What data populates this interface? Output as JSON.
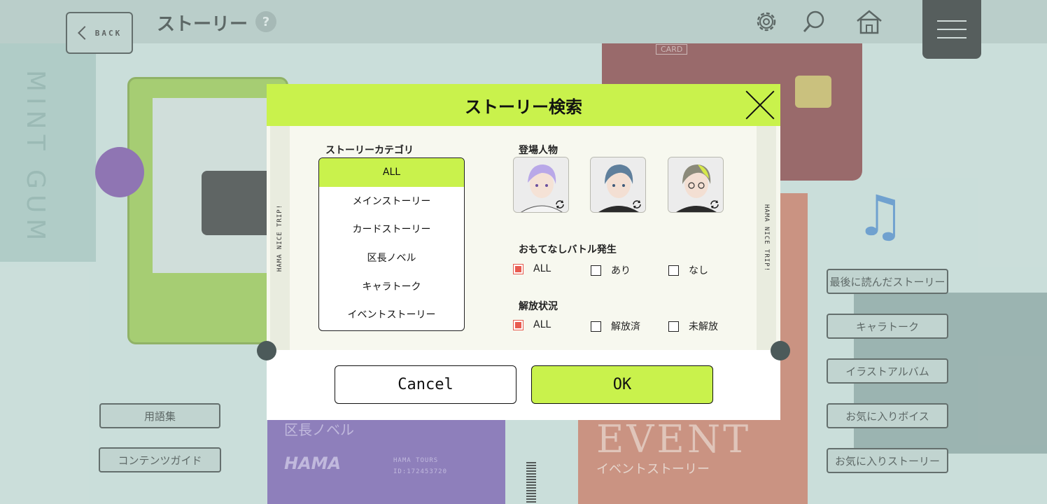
{
  "header": {
    "back_label": "BACK",
    "title": "ストーリー",
    "help_symbol": "?",
    "icons": [
      "gear-icon",
      "search-icon",
      "home-icon",
      "menu-icon"
    ]
  },
  "background": {
    "mint_text": "MINT GUM",
    "card_label": "CARD",
    "novel_title": "区長ノベル",
    "novel_logo": "HAMA",
    "novel_meta_1": "HAMA TOURS",
    "novel_meta_2": "ID:172453720",
    "event_title": "EVENT",
    "event_sub": "イベントストーリー",
    "left_buttons": [
      "用語集",
      "コンテンツガイド"
    ],
    "right_buttons": [
      "最後に読んだストーリー",
      "キャラトーク",
      "イラストアルバム",
      "お気に入りボイス",
      "お気に入りストーリー"
    ]
  },
  "dialog": {
    "title": "ストーリー検索",
    "side_text": "HAMA NICE TRIP!",
    "category_label": "ストーリーカテゴリ",
    "categories": [
      "ALL",
      "メインストーリー",
      "カードストーリー",
      "区長ノベル",
      "キャラトーク",
      "イベントストーリー"
    ],
    "selected_category": "ALL",
    "characters_label": "登場人物",
    "battle_label": "おもてなしバトル発生",
    "battle_options": [
      "ALL",
      "あり",
      "なし"
    ],
    "unlock_label": "解放状況",
    "unlock_options": [
      "ALL",
      "解放済",
      "未解放"
    ],
    "cancel_label": "Cancel",
    "ok_label": "OK",
    "accent_color": "#c9f24c",
    "check_color": "#e85a4f"
  }
}
